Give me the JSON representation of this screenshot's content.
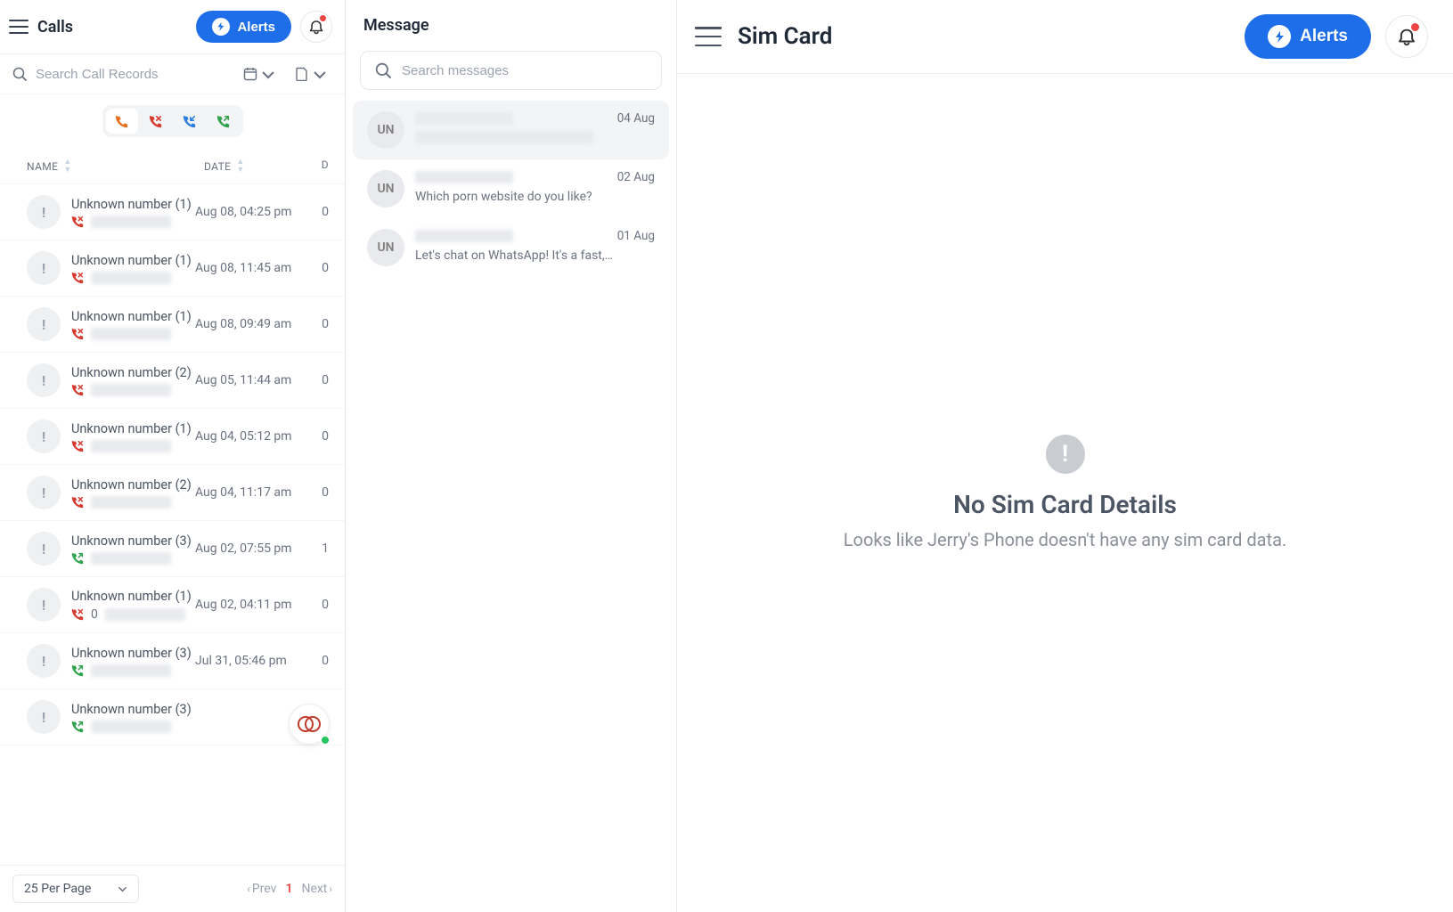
{
  "calls": {
    "title": "Calls",
    "alerts_label": "Alerts",
    "search_placeholder": "Search Call Records",
    "columns": {
      "name": "NAME",
      "date": "DATE",
      "d": "D"
    },
    "rows": [
      {
        "name": "Unknown number (1)",
        "type": "missed",
        "date": "Aug 08, 04:25 pm",
        "d": "0"
      },
      {
        "name": "Unknown number (1)",
        "type": "missed",
        "date": "Aug 08, 11:45 am",
        "d": "0"
      },
      {
        "name": "Unknown number (1)",
        "type": "missed",
        "date": "Aug 08, 09:49 am",
        "d": "0"
      },
      {
        "name": "Unknown number (2)",
        "type": "missed",
        "date": "Aug 05, 11:44 am",
        "d": "0"
      },
      {
        "name": "Unknown number (1)",
        "type": "missed",
        "date": "Aug 04, 05:12 pm",
        "d": "0"
      },
      {
        "name": "Unknown number (2)",
        "type": "missed",
        "date": "Aug 04, 11:17 am",
        "d": "0"
      },
      {
        "name": "Unknown number (3)",
        "type": "outgoing",
        "date": "Aug 02, 07:55 pm",
        "d": "1"
      },
      {
        "name": "Unknown number (1)",
        "type": "missed",
        "date": "Aug 02, 04:11 pm",
        "d": "0",
        "sub_prefix": "0"
      },
      {
        "name": "Unknown number (3)",
        "type": "outgoing",
        "date": "Jul 31, 05:46 pm",
        "d": "0"
      },
      {
        "name": "Unknown number (3)",
        "type": "outgoing",
        "date": "",
        "d": ""
      }
    ],
    "pagination": {
      "per_page": "25 Per Page",
      "prev": "Prev",
      "current": "1",
      "next": "Next"
    }
  },
  "messages": {
    "title": "Message",
    "search_placeholder": "Search messages",
    "items": [
      {
        "avatar": "UN",
        "date": "04 Aug",
        "preview": "",
        "selected": true
      },
      {
        "avatar": "UN",
        "date": "02 Aug",
        "preview": "Which porn website do you like?"
      },
      {
        "avatar": "UN",
        "date": "01 Aug",
        "preview": "Let's chat on WhatsApp! It's a fast,…"
      }
    ]
  },
  "sim": {
    "title": "Sim Card",
    "alerts_label": "Alerts",
    "empty_title": "No Sim Card Details",
    "empty_sub": "Looks like Jerry's Phone doesn't have any sim card data."
  }
}
